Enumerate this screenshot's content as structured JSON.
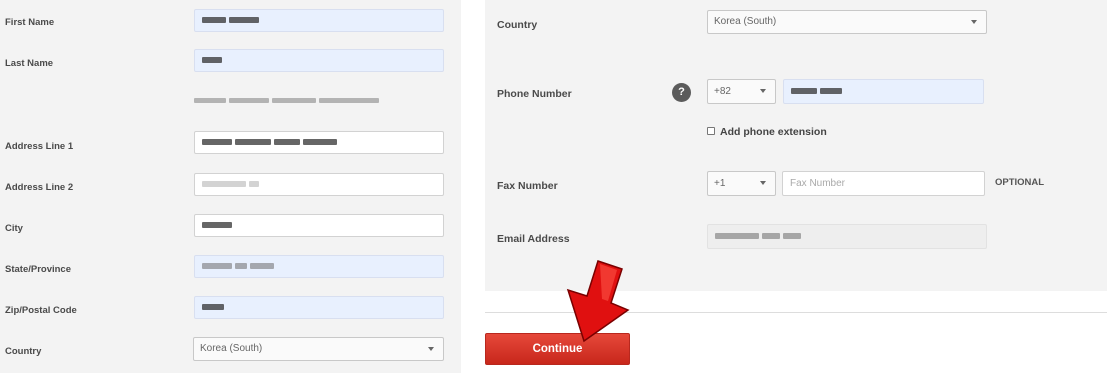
{
  "left_form": {
    "first_name_label": "First Name",
    "last_name_label": "Last Name",
    "address1_label": "Address Line 1",
    "address2_label": "Address Line 2",
    "city_label": "City",
    "state_label": "State/Province",
    "zip_label": "Zip/Postal Code",
    "country_label": "Country",
    "country_value": "Korea (South)"
  },
  "right_form": {
    "country_label": "Country",
    "country_value": "Korea (South)",
    "phone_label": "Phone Number",
    "help_glyph": "?",
    "phone_code": "+82",
    "add_extension_label": "Add phone extension",
    "fax_label": "Fax Number",
    "fax_code": "+1",
    "fax_placeholder": "Fax Number",
    "optional_label": "OPTIONAL",
    "email_label": "Email Address"
  },
  "actions": {
    "continue_label": "Continue"
  },
  "icons": {
    "help": "question-circle-icon",
    "dropdown": "chevron-down-icon",
    "annotation": "red-arrow-icon"
  },
  "colors": {
    "panel_bg": "#f3f3f3",
    "autofill_bg": "#e8f0fe",
    "button_red": "#d9372a",
    "arrow_red": "#e01010"
  }
}
